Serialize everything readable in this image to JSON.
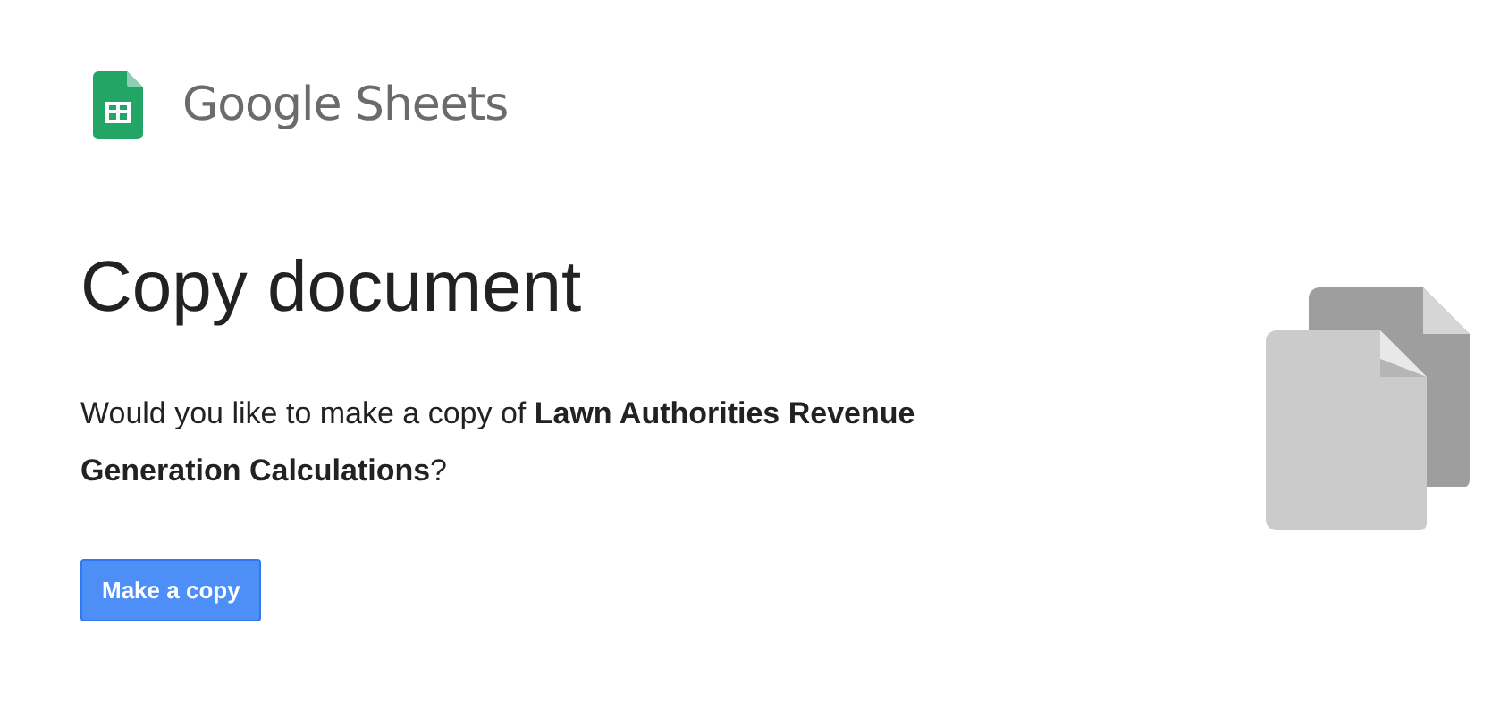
{
  "brand": {
    "name": "Google Sheets"
  },
  "title": "Copy document",
  "message": "Would you like to make a copy of **Lawn Authorities Revenue Generation Calculations**?",
  "button": {
    "label": "Make a copy"
  }
}
